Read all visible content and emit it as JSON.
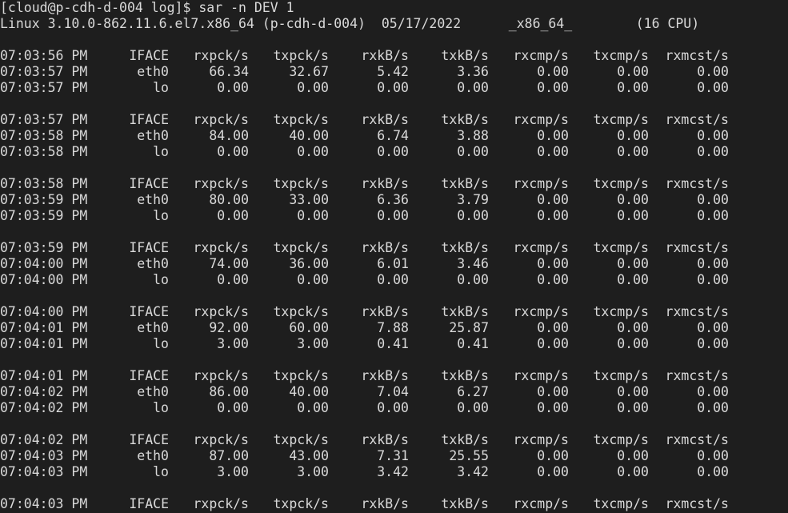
{
  "terminal": {
    "bg": "#1e1e1e",
    "fg": "#d9d9d9",
    "prompt_line": "[cloud@p-cdh-d-004 log]$ sar -n DEV 1",
    "header_line": "Linux 3.10.0-862.11.6.el7.x86_64 (p-cdh-d-004)  05/17/2022      _x86_64_        (16 CPU)"
  },
  "columns": [
    "IFACE",
    "rxpck/s",
    "txpck/s",
    "rxkB/s",
    "txkB/s",
    "rxcmp/s",
    "txcmp/s",
    "rxmcst/s"
  ],
  "blocks": [
    {
      "header_time": "07:03:56 PM",
      "rows": [
        {
          "time": "07:03:57 PM",
          "iface": "eth0",
          "vals": [
            "66.34",
            "32.67",
            "5.42",
            "3.36",
            "0.00",
            "0.00",
            "0.00"
          ]
        },
        {
          "time": "07:03:57 PM",
          "iface": "lo",
          "vals": [
            "0.00",
            "0.00",
            "0.00",
            "0.00",
            "0.00",
            "0.00",
            "0.00"
          ]
        }
      ]
    },
    {
      "header_time": "07:03:57 PM",
      "rows": [
        {
          "time": "07:03:58 PM",
          "iface": "eth0",
          "vals": [
            "84.00",
            "40.00",
            "6.74",
            "3.88",
            "0.00",
            "0.00",
            "0.00"
          ]
        },
        {
          "time": "07:03:58 PM",
          "iface": "lo",
          "vals": [
            "0.00",
            "0.00",
            "0.00",
            "0.00",
            "0.00",
            "0.00",
            "0.00"
          ]
        }
      ]
    },
    {
      "header_time": "07:03:58 PM",
      "rows": [
        {
          "time": "07:03:59 PM",
          "iface": "eth0",
          "vals": [
            "80.00",
            "33.00",
            "6.36",
            "3.79",
            "0.00",
            "0.00",
            "0.00"
          ]
        },
        {
          "time": "07:03:59 PM",
          "iface": "lo",
          "vals": [
            "0.00",
            "0.00",
            "0.00",
            "0.00",
            "0.00",
            "0.00",
            "0.00"
          ]
        }
      ]
    },
    {
      "header_time": "07:03:59 PM",
      "rows": [
        {
          "time": "07:04:00 PM",
          "iface": "eth0",
          "vals": [
            "74.00",
            "36.00",
            "6.01",
            "3.46",
            "0.00",
            "0.00",
            "0.00"
          ]
        },
        {
          "time": "07:04:00 PM",
          "iface": "lo",
          "vals": [
            "0.00",
            "0.00",
            "0.00",
            "0.00",
            "0.00",
            "0.00",
            "0.00"
          ]
        }
      ]
    },
    {
      "header_time": "07:04:00 PM",
      "rows": [
        {
          "time": "07:04:01 PM",
          "iface": "eth0",
          "vals": [
            "92.00",
            "60.00",
            "7.88",
            "25.87",
            "0.00",
            "0.00",
            "0.00"
          ]
        },
        {
          "time": "07:04:01 PM",
          "iface": "lo",
          "vals": [
            "3.00",
            "3.00",
            "0.41",
            "0.41",
            "0.00",
            "0.00",
            "0.00"
          ]
        }
      ]
    },
    {
      "header_time": "07:04:01 PM",
      "rows": [
        {
          "time": "07:04:02 PM",
          "iface": "eth0",
          "vals": [
            "86.00",
            "40.00",
            "7.04",
            "6.27",
            "0.00",
            "0.00",
            "0.00"
          ]
        },
        {
          "time": "07:04:02 PM",
          "iface": "lo",
          "vals": [
            "0.00",
            "0.00",
            "0.00",
            "0.00",
            "0.00",
            "0.00",
            "0.00"
          ]
        }
      ]
    },
    {
      "header_time": "07:04:02 PM",
      "rows": [
        {
          "time": "07:04:03 PM",
          "iface": "eth0",
          "vals": [
            "87.00",
            "43.00",
            "7.31",
            "25.55",
            "0.00",
            "0.00",
            "0.00"
          ]
        },
        {
          "time": "07:04:03 PM",
          "iface": "lo",
          "vals": [
            "3.00",
            "3.00",
            "3.42",
            "3.42",
            "0.00",
            "0.00",
            "0.00"
          ]
        }
      ]
    },
    {
      "header_time": "07:04:03 PM",
      "rows": []
    }
  ]
}
